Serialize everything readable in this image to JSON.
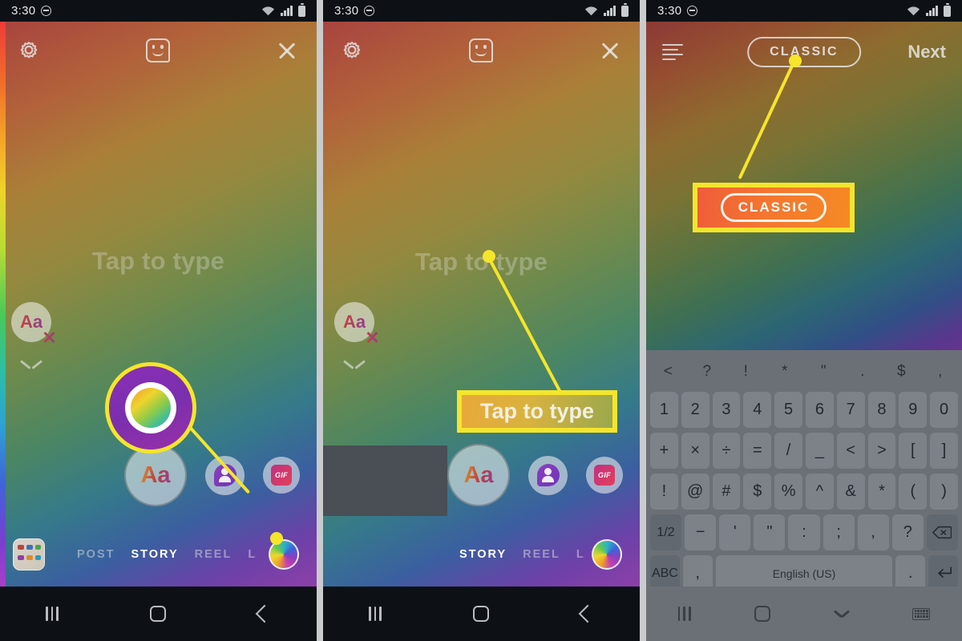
{
  "status_bar": {
    "time": "3:30",
    "dnd_icon": "do-not-disturb-icon",
    "wifi_icon": "wifi-icon",
    "signal_icon": "cell-signal-icon",
    "battery_icon": "battery-icon"
  },
  "panel1": {
    "toolbar": {
      "settings_icon": "gear-icon",
      "sticker_icon": "sticker-smiley-icon",
      "close_icon": "close-x-icon"
    },
    "placeholder": "Tap to type",
    "text_chip": {
      "label": "Aa",
      "delete_icon": "close-circle-icon"
    },
    "collapse_icon": "chevron-down-icon",
    "tools": {
      "text_label": "Aa",
      "avatar_icon": "avatar-icon",
      "gif_label": "GIF"
    },
    "gallery_icon": "gallery-thumbnail-icon",
    "modes": [
      {
        "label": "POST",
        "active": false
      },
      {
        "label": "STORY",
        "active": true
      },
      {
        "label": "REEL",
        "active": false
      },
      {
        "label": "L",
        "active": false
      }
    ],
    "color_button": "rainbow-color-wheel-button",
    "annotation": {
      "type": "magnifier-callout",
      "target": "rainbow-color-wheel-button",
      "accent": "#f5e52b"
    }
  },
  "panel2": {
    "toolbar": {
      "settings_icon": "gear-icon",
      "sticker_icon": "sticker-smiley-icon",
      "close_icon": "close-x-icon"
    },
    "placeholder": "Tap to type",
    "text_chip": {
      "label": "Aa",
      "delete_icon": "close-circle-icon"
    },
    "collapse_icon": "chevron-down-icon",
    "tools": {
      "text_label": "Aa",
      "avatar_icon": "avatar-icon",
      "gif_label": "GIF"
    },
    "modes": [
      {
        "label": "STORY",
        "active": true
      },
      {
        "label": "REEL",
        "active": false
      },
      {
        "label": "L",
        "active": false
      }
    ],
    "color_button": "rainbow-color-wheel-button",
    "callout": {
      "label": "Tap to type",
      "accent": "#f5e52b"
    }
  },
  "panel3": {
    "toolbar": {
      "align_icon": "text-align-icon",
      "font_label": "CLASSIC",
      "next_label": "Next"
    },
    "callout": {
      "label": "CLASSIC",
      "accent": "#f5e52b"
    },
    "keyboard": {
      "suggestions": [
        "<",
        "?",
        "!",
        "*",
        "\"",
        ".",
        "$",
        ","
      ],
      "rows": [
        [
          "1",
          "2",
          "3",
          "4",
          "5",
          "6",
          "7",
          "8",
          "9",
          "0"
        ],
        [
          "+",
          "×",
          "÷",
          "=",
          "/",
          "_",
          "<",
          ">",
          "[",
          "]"
        ],
        [
          "!",
          "@",
          "#",
          "$",
          "%",
          "^",
          "&",
          "*",
          "(",
          ")"
        ]
      ],
      "row4": {
        "page_label": "1/2",
        "keys": [
          "−",
          "'",
          "\"",
          ":",
          ";",
          ",",
          "?"
        ],
        "backspace_icon": "backspace-icon"
      },
      "row5": {
        "abc_label": "ABC",
        "comma_label": ",",
        "space_label": "English (US)",
        "period_label": ".",
        "enter_icon": "enter-return-icon"
      }
    }
  },
  "nav_bar": {
    "recents_icon": "recent-apps-icon",
    "home_icon": "home-icon",
    "back_icon": "back-icon",
    "hide_keyboard_icon": "chevron-down-icon",
    "keyboard_switch_icon": "keyboard-icon"
  },
  "colors": {
    "accent_yellow": "#f5e52b",
    "callout_orange": "#f4762f",
    "nav_dark": "#0d1115",
    "keyboard_grey": "#6b7076"
  }
}
